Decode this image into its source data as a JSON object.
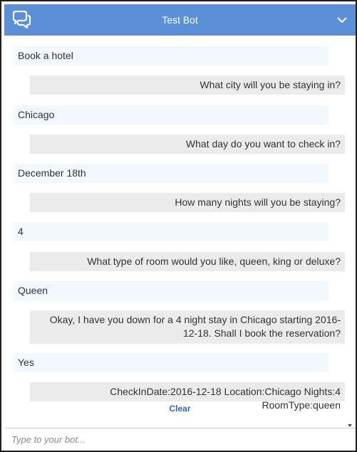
{
  "header": {
    "title": "Test Bot",
    "chat_icon": "chat-bubbles-icon",
    "collapse_icon": "chevron-down-icon",
    "color": "#5b90d8"
  },
  "messages": [
    {
      "role": "user",
      "text": "Book a hotel"
    },
    {
      "role": "bot",
      "text": "What city will you be staying in?"
    },
    {
      "role": "user",
      "text": "Chicago"
    },
    {
      "role": "bot",
      "text": "What day do you want to check in?"
    },
    {
      "role": "user",
      "text": "December 18th"
    },
    {
      "role": "bot",
      "text": "How many nights will you be staying?"
    },
    {
      "role": "user",
      "text": "4"
    },
    {
      "role": "bot",
      "text": "What type of room would you like, queen, king or deluxe?"
    },
    {
      "role": "user",
      "text": "Queen"
    },
    {
      "role": "bot",
      "text": "Okay, I have you down for a 4 night stay in Chicago starting 2016-12-18. Shall I book the reservation?"
    },
    {
      "role": "user",
      "text": "Yes"
    },
    {
      "role": "bot",
      "text": "CheckInDate:2016-12-18 Location:Chicago Nights:4 RoomType:queen"
    }
  ],
  "clear_label": "Clear",
  "input": {
    "placeholder": "Type to your bot...",
    "value": ""
  },
  "colors": {
    "user_bubble": "#f1f8ff",
    "bot_bubble": "#ebebeb",
    "link": "#2a6cb8"
  }
}
